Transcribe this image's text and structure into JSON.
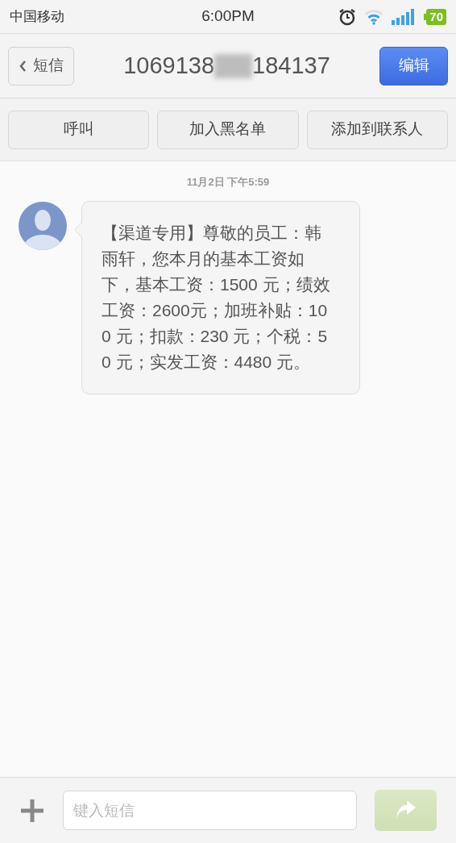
{
  "status_bar": {
    "carrier": "中国移动",
    "time": "6:00PM",
    "battery": "70"
  },
  "header": {
    "back_label": "短信",
    "number_start": "1069138",
    "number_end": "184137",
    "edit_label": "编辑"
  },
  "actions": [
    "呼叫",
    "加入黑名单",
    "添加到联系人"
  ],
  "messages": [
    {
      "timestamp": "11月2日 下午5:59",
      "text": "【渠道专用】尊敬的员工：韩雨轩，您本月的基本工资如下，基本工资：1500 元；绩效工资：2600元；加班补贴：100 元；扣款：230 元；个税：50 元；实发工资：4480 元。"
    }
  ],
  "composer": {
    "placeholder": "键入短信",
    "send_disabled": true
  }
}
